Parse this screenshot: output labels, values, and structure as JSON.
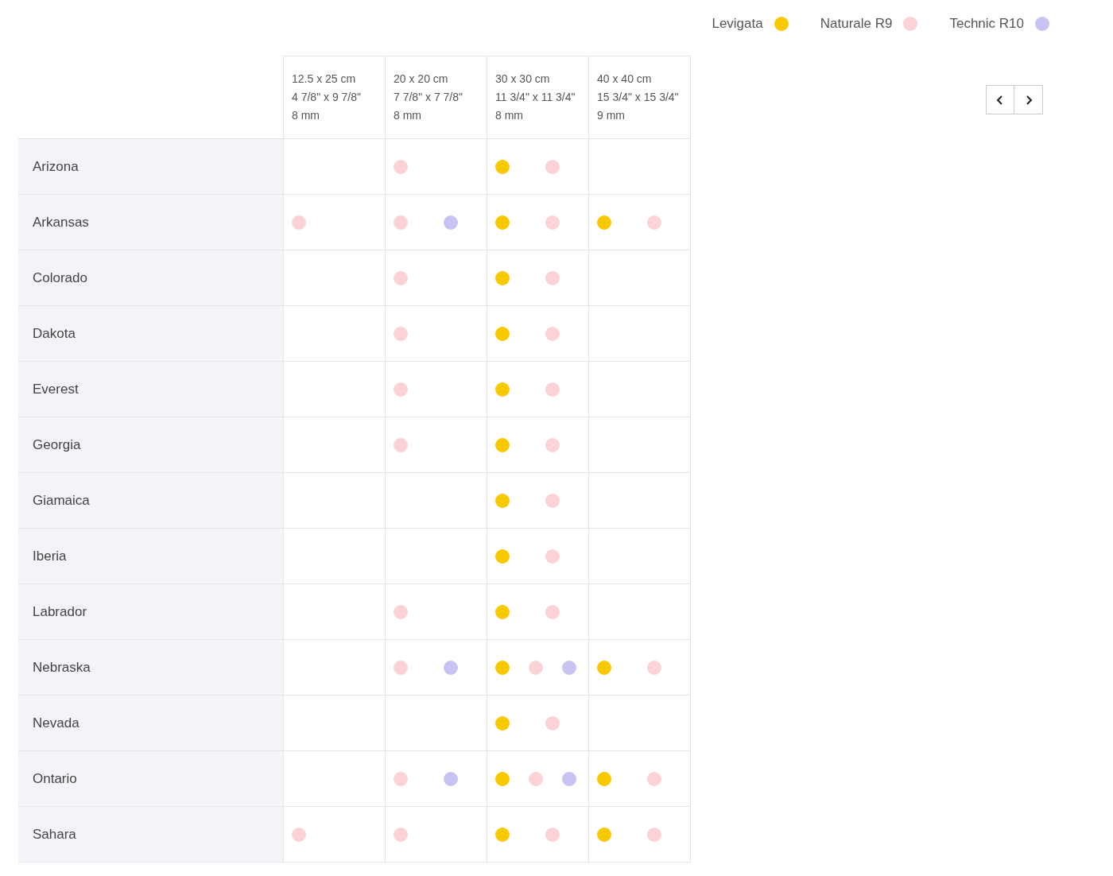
{
  "legend": [
    {
      "label": "Levigata",
      "color": "#f9c900"
    },
    {
      "label": "Naturale R9",
      "color": "#fbd3d6"
    },
    {
      "label": "Technic R10",
      "color": "#c7c4f4"
    }
  ],
  "table": {
    "columns": [
      {
        "size": "12.5 x 25 cm",
        "inches": "4 7/8\" x 9 7/8\"",
        "thickness": "8 mm"
      },
      {
        "size": "20 x 20 cm",
        "inches": "7 7/8\" x 7 7/8\"",
        "thickness": "8 mm"
      },
      {
        "size": "30 x 30 cm",
        "inches": "11 3/4\" x 11 3/4\"",
        "thickness": "8 mm"
      },
      {
        "size": "40 x 40 cm",
        "inches": "15 3/4\" x 15 3/4\"",
        "thickness": "9 mm"
      }
    ],
    "rows": [
      {
        "name": "Arizona",
        "cells": [
          {},
          {
            "dots": [
              {
                "color": "#fbd3d6"
              }
            ]
          },
          {
            "dots": [
              {
                "color": "#f9c900"
              },
              {
                "color": "#fbd3d6"
              }
            ]
          },
          {}
        ]
      },
      {
        "name": "Arkansas",
        "cells": [
          {
            "dots": [
              {
                "color": "#fbd3d6"
              }
            ]
          },
          {
            "dots": [
              {
                "color": "#fbd3d6"
              },
              {
                "color": "#c7c4f4"
              }
            ]
          },
          {
            "dots": [
              {
                "color": "#f9c900"
              },
              {
                "color": "#fbd3d6"
              }
            ]
          },
          {
            "dots": [
              {
                "color": "#f9c900"
              },
              {
                "color": "#fbd3d6"
              }
            ]
          }
        ]
      },
      {
        "name": "Colorado",
        "cells": [
          {},
          {
            "dots": [
              {
                "color": "#fbd3d6"
              }
            ]
          },
          {
            "dots": [
              {
                "color": "#f9c900"
              },
              {
                "color": "#fbd3d6"
              }
            ]
          },
          {}
        ]
      },
      {
        "name": "Dakota",
        "cells": [
          {},
          {
            "dots": [
              {
                "color": "#fbd3d6"
              }
            ]
          },
          {
            "dots": [
              {
                "color": "#f9c900"
              },
              {
                "color": "#fbd3d6"
              }
            ]
          },
          {}
        ]
      },
      {
        "name": "Everest",
        "cells": [
          {},
          {
            "dots": [
              {
                "color": "#fbd3d6"
              }
            ]
          },
          {
            "dots": [
              {
                "color": "#f9c900"
              },
              {
                "color": "#fbd3d6"
              }
            ]
          },
          {}
        ]
      },
      {
        "name": "Georgia",
        "cells": [
          {},
          {
            "dots": [
              {
                "color": "#fbd3d6"
              }
            ]
          },
          {
            "dots": [
              {
                "color": "#f9c900"
              },
              {
                "color": "#fbd3d6"
              }
            ]
          },
          {}
        ]
      },
      {
        "name": "Giamaica",
        "cells": [
          {},
          {},
          {
            "dots": [
              {
                "color": "#f9c900"
              },
              {
                "color": "#fbd3d6"
              }
            ]
          },
          {}
        ]
      },
      {
        "name": "Iberia",
        "cells": [
          {},
          {},
          {
            "dots": [
              {
                "color": "#f9c900"
              },
              {
                "color": "#fbd3d6"
              }
            ]
          },
          {}
        ]
      },
      {
        "name": "Labrador",
        "cells": [
          {},
          {
            "dots": [
              {
                "color": "#fbd3d6"
              }
            ]
          },
          {
            "dots": [
              {
                "color": "#f9c900"
              },
              {
                "color": "#fbd3d6"
              }
            ]
          },
          {}
        ]
      },
      {
        "name": "Nebraska",
        "cells": [
          {},
          {
            "dots": [
              {
                "color": "#fbd3d6"
              },
              {
                "color": "#c7c4f4"
              }
            ]
          },
          {
            "dots": [
              {
                "color": "#f9c900"
              },
              {
                "color": "#fbd3d6"
              },
              {
                "color": "#c7c4f4"
              }
            ]
          },
          {
            "dots": [
              {
                "color": "#f9c900"
              },
              {
                "color": "#fbd3d6"
              }
            ]
          }
        ]
      },
      {
        "name": "Nevada",
        "cells": [
          {},
          {},
          {
            "dots": [
              {
                "color": "#f9c900"
              },
              {
                "color": "#fbd3d6"
              }
            ]
          },
          {}
        ]
      },
      {
        "name": "Ontario",
        "cells": [
          {},
          {
            "dots": [
              {
                "color": "#fbd3d6"
              },
              {
                "color": "#c7c4f4"
              }
            ]
          },
          {
            "dots": [
              {
                "color": "#f9c900"
              },
              {
                "color": "#fbd3d6"
              },
              {
                "color": "#c7c4f4"
              }
            ]
          },
          {
            "dots": [
              {
                "color": "#f9c900"
              },
              {
                "color": "#fbd3d6"
              }
            ]
          }
        ]
      },
      {
        "name": "Sahara",
        "cells": [
          {
            "dots": [
              {
                "color": "#fbd3d6"
              }
            ]
          },
          {
            "dots": [
              {
                "color": "#fbd3d6"
              }
            ]
          },
          {
            "dots": [
              {
                "color": "#f9c900"
              },
              {
                "color": "#fbd3d6"
              }
            ]
          },
          {
            "dots": [
              {
                "color": "#f9c900"
              },
              {
                "color": "#fbd3d6"
              }
            ]
          }
        ]
      }
    ]
  }
}
